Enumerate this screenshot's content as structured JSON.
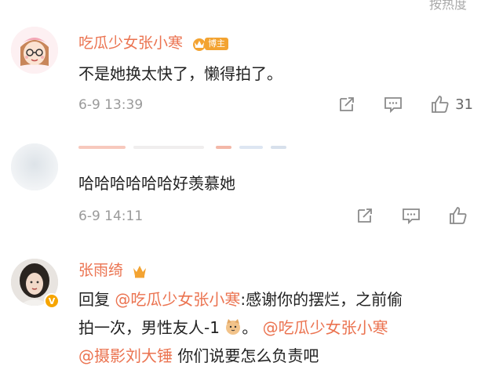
{
  "header": {
    "sort_label": "按热度"
  },
  "comments": [
    {
      "username": "吃瓜少女张小寒",
      "badge_label": "博主",
      "text": "不是她换太快了，懒得拍了。",
      "time": "6-9 13:39",
      "likes": "31"
    },
    {
      "username": "",
      "text": "哈哈哈哈哈哈好羡慕她",
      "time": "6-9 14:11",
      "likes": ""
    },
    {
      "username": "张雨绮",
      "reply_prefix": "回复",
      "reply_mention": "@吃瓜少女张小寒",
      "reply_text_1": ":感谢你的摆烂，之前偷",
      "reply_text_2": "拍一次，男性友人-1",
      "reply_text_3": "。",
      "mention_2": "@吃瓜少女张小寒",
      "mention_3": "@摄影刘大锤",
      "reply_text_4": " 你们说要怎么负责吧",
      "verified_mark": "V"
    }
  ],
  "colors": {
    "accent": "#eb7350",
    "muted": "#9a9a9a",
    "badge": "#f3a331"
  }
}
